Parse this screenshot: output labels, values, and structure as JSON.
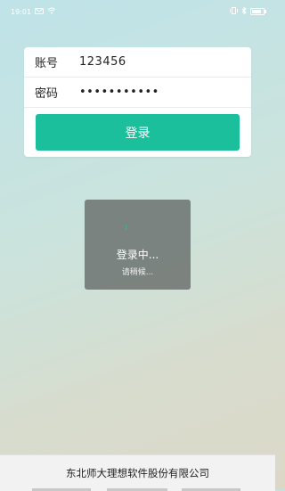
{
  "status_bar": {
    "time": "19:01",
    "left_icons": [
      "message-icon",
      "wifi-icon"
    ],
    "right_icons": [
      "vibrate-icon",
      "bluetooth-icon",
      "battery-icon"
    ]
  },
  "form": {
    "account_label": "账号",
    "account_value": "123456",
    "password_label": "密码",
    "password_value": "•••••••••••"
  },
  "login_button_label": "登录",
  "loading": {
    "title": "登录中...",
    "subtitle": "请稍候..."
  },
  "footer_text": "东北师大理想软件股份有限公司",
  "colors": {
    "accent": "#1cbf9c",
    "spinner": "#1cbf9c"
  }
}
